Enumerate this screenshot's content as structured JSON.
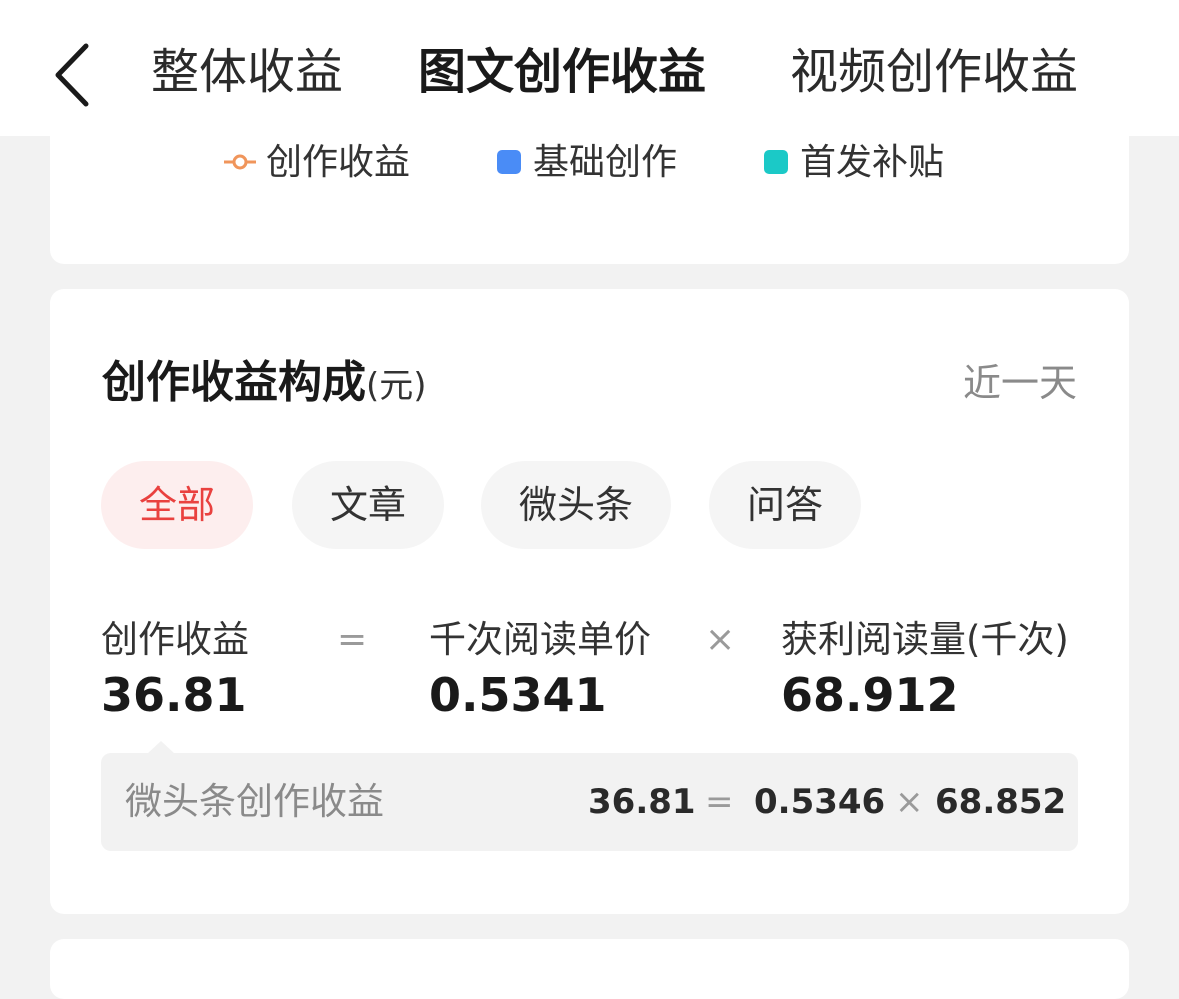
{
  "header": {
    "tabs": [
      {
        "label": "整体收益",
        "active": false
      },
      {
        "label": "图文创作收益",
        "active": true
      },
      {
        "label": "视频创作收益",
        "active": false
      }
    ],
    "back_icon": "chevron-left-icon"
  },
  "legend": {
    "items": [
      {
        "label": "创作收益",
        "color": "#f0955b",
        "shape": "line-circle"
      },
      {
        "label": "基础创作",
        "color": "#4a8cf6",
        "shape": "square"
      },
      {
        "label": "首发补贴",
        "color": "#1bc9c7",
        "shape": "square"
      }
    ]
  },
  "composition": {
    "title": "创作收益构成",
    "unit": "(元)",
    "period": "近一天",
    "filters": [
      {
        "label": "全部",
        "active": true
      },
      {
        "label": "文章",
        "active": false
      },
      {
        "label": "微头条",
        "active": false
      },
      {
        "label": "问答",
        "active": false
      }
    ],
    "formula": {
      "revenue_label": "创作收益",
      "revenue_value": "36.81",
      "equals": "=",
      "price_label": "千次阅读单价",
      "price_value": "0.5341",
      "times": "×",
      "reads_label": "获利阅读量(千次)",
      "reads_value": "68.912"
    },
    "breakdown": {
      "label": "微头条创作收益",
      "revenue": "36.81",
      "equals": "=",
      "price": "0.5346",
      "times": "×",
      "reads": "68.852"
    }
  },
  "colors": {
    "accent": "#e9413f",
    "background": "#f2f2f2"
  }
}
